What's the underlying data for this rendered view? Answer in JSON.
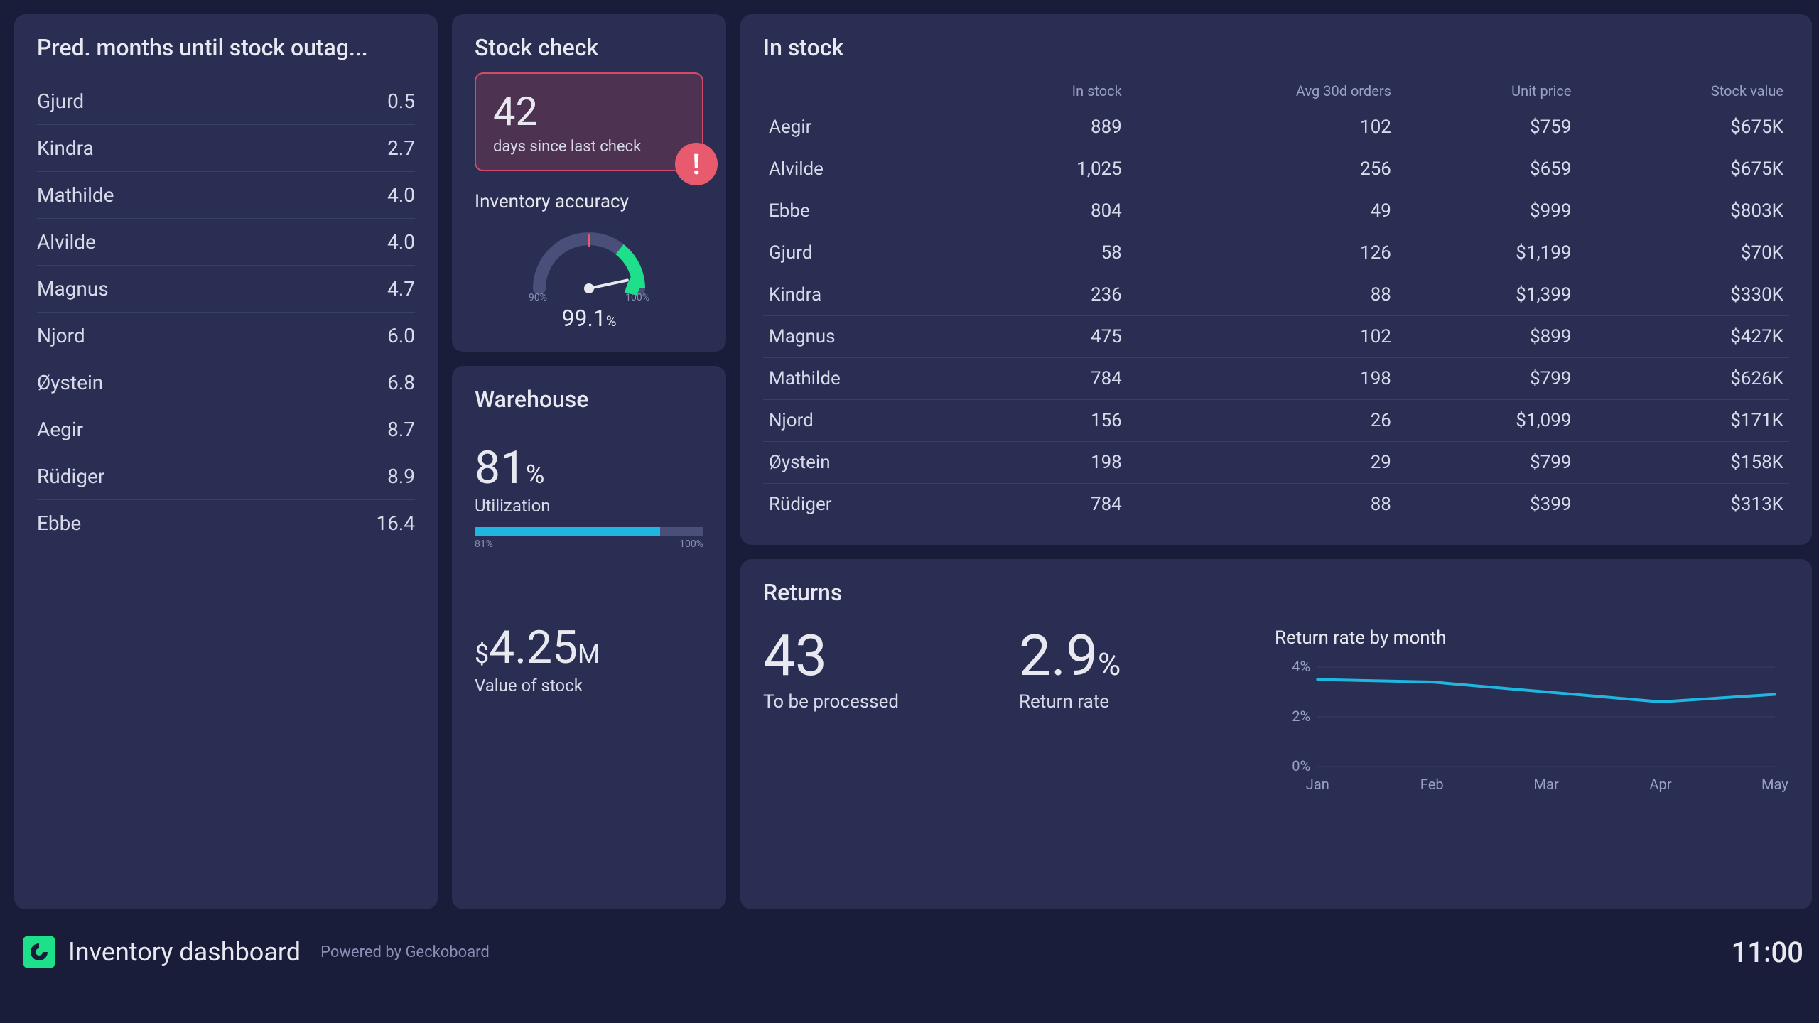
{
  "pred": {
    "title": "Pred. months until stock outag...",
    "rows": [
      {
        "name": "Gjurd",
        "val": "0.5"
      },
      {
        "name": "Kindra",
        "val": "2.7"
      },
      {
        "name": "Mathilde",
        "val": "4.0"
      },
      {
        "name": "Alvilde",
        "val": "4.0"
      },
      {
        "name": "Magnus",
        "val": "4.7"
      },
      {
        "name": "Njord",
        "val": "6.0"
      },
      {
        "name": "Øystein",
        "val": "6.8"
      },
      {
        "name": "Aegir",
        "val": "8.7"
      },
      {
        "name": "Rüdiger",
        "val": "8.9"
      },
      {
        "name": "Ebbe",
        "val": "16.4"
      }
    ]
  },
  "stock_check": {
    "title": "Stock check",
    "days": "42",
    "days_sub": "days since last check",
    "alert_icon": "!",
    "accuracy_title": "Inventory accuracy",
    "accuracy_value": "99.1",
    "accuracy_unit": "%",
    "gauge_min": "90%",
    "gauge_max": "100%"
  },
  "warehouse": {
    "title": "Warehouse",
    "util_value": "81",
    "util_unit": "%",
    "util_label": "Utilization",
    "util_bar_pct": 81,
    "util_bar_left": "81%",
    "util_bar_right": "100%",
    "stock_prefix": "$",
    "stock_value": "4.25",
    "stock_suffix": "M",
    "stock_label": "Value of stock"
  },
  "in_stock": {
    "title": "In stock",
    "headers": [
      "",
      "In stock",
      "Avg 30d orders",
      "Unit price",
      "Stock value"
    ],
    "rows": [
      {
        "name": "Aegir",
        "stock": "889",
        "orders": "102",
        "price": "$759",
        "value": "$675K"
      },
      {
        "name": "Alvilde",
        "stock": "1,025",
        "orders": "256",
        "price": "$659",
        "value": "$675K"
      },
      {
        "name": "Ebbe",
        "stock": "804",
        "orders": "49",
        "price": "$999",
        "value": "$803K"
      },
      {
        "name": "Gjurd",
        "stock": "58",
        "orders": "126",
        "price": "$1,199",
        "value": "$70K"
      },
      {
        "name": "Kindra",
        "stock": "236",
        "orders": "88",
        "price": "$1,399",
        "value": "$330K"
      },
      {
        "name": "Magnus",
        "stock": "475",
        "orders": "102",
        "price": "$899",
        "value": "$427K"
      },
      {
        "name": "Mathilde",
        "stock": "784",
        "orders": "198",
        "price": "$799",
        "value": "$626K"
      },
      {
        "name": "Njord",
        "stock": "156",
        "orders": "26",
        "price": "$1,099",
        "value": "$171K"
      },
      {
        "name": "Øystein",
        "stock": "198",
        "orders": "29",
        "price": "$799",
        "value": "$158K"
      },
      {
        "name": "Rüdiger",
        "stock": "784",
        "orders": "88",
        "price": "$399",
        "value": "$313K"
      }
    ]
  },
  "returns": {
    "title": "Returns",
    "to_process": "43",
    "to_process_label": "To be processed",
    "rate": "2.9",
    "rate_unit": "%",
    "rate_label": "Return rate",
    "chart_title": "Return rate by month"
  },
  "chart_data": {
    "type": "line",
    "title": "Return rate by month",
    "xlabel": "",
    "ylabel": "",
    "ylim": [
      0,
      4
    ],
    "categories": [
      "Jan",
      "Feb",
      "Mar",
      "Apr",
      "May"
    ],
    "y_ticks": [
      "0%",
      "2%",
      "4%"
    ],
    "values": [
      3.5,
      3.4,
      3.0,
      2.6,
      2.9
    ]
  },
  "footer": {
    "title": "Inventory dashboard",
    "powered": "Powered by Geckoboard",
    "time": "11:00"
  },
  "colors": {
    "bg": "#1a1d3a",
    "card": "#2a2e52",
    "accent_cyan": "#1fb6e0",
    "accent_green": "#1fe08a",
    "alert": "#e85a6e"
  }
}
